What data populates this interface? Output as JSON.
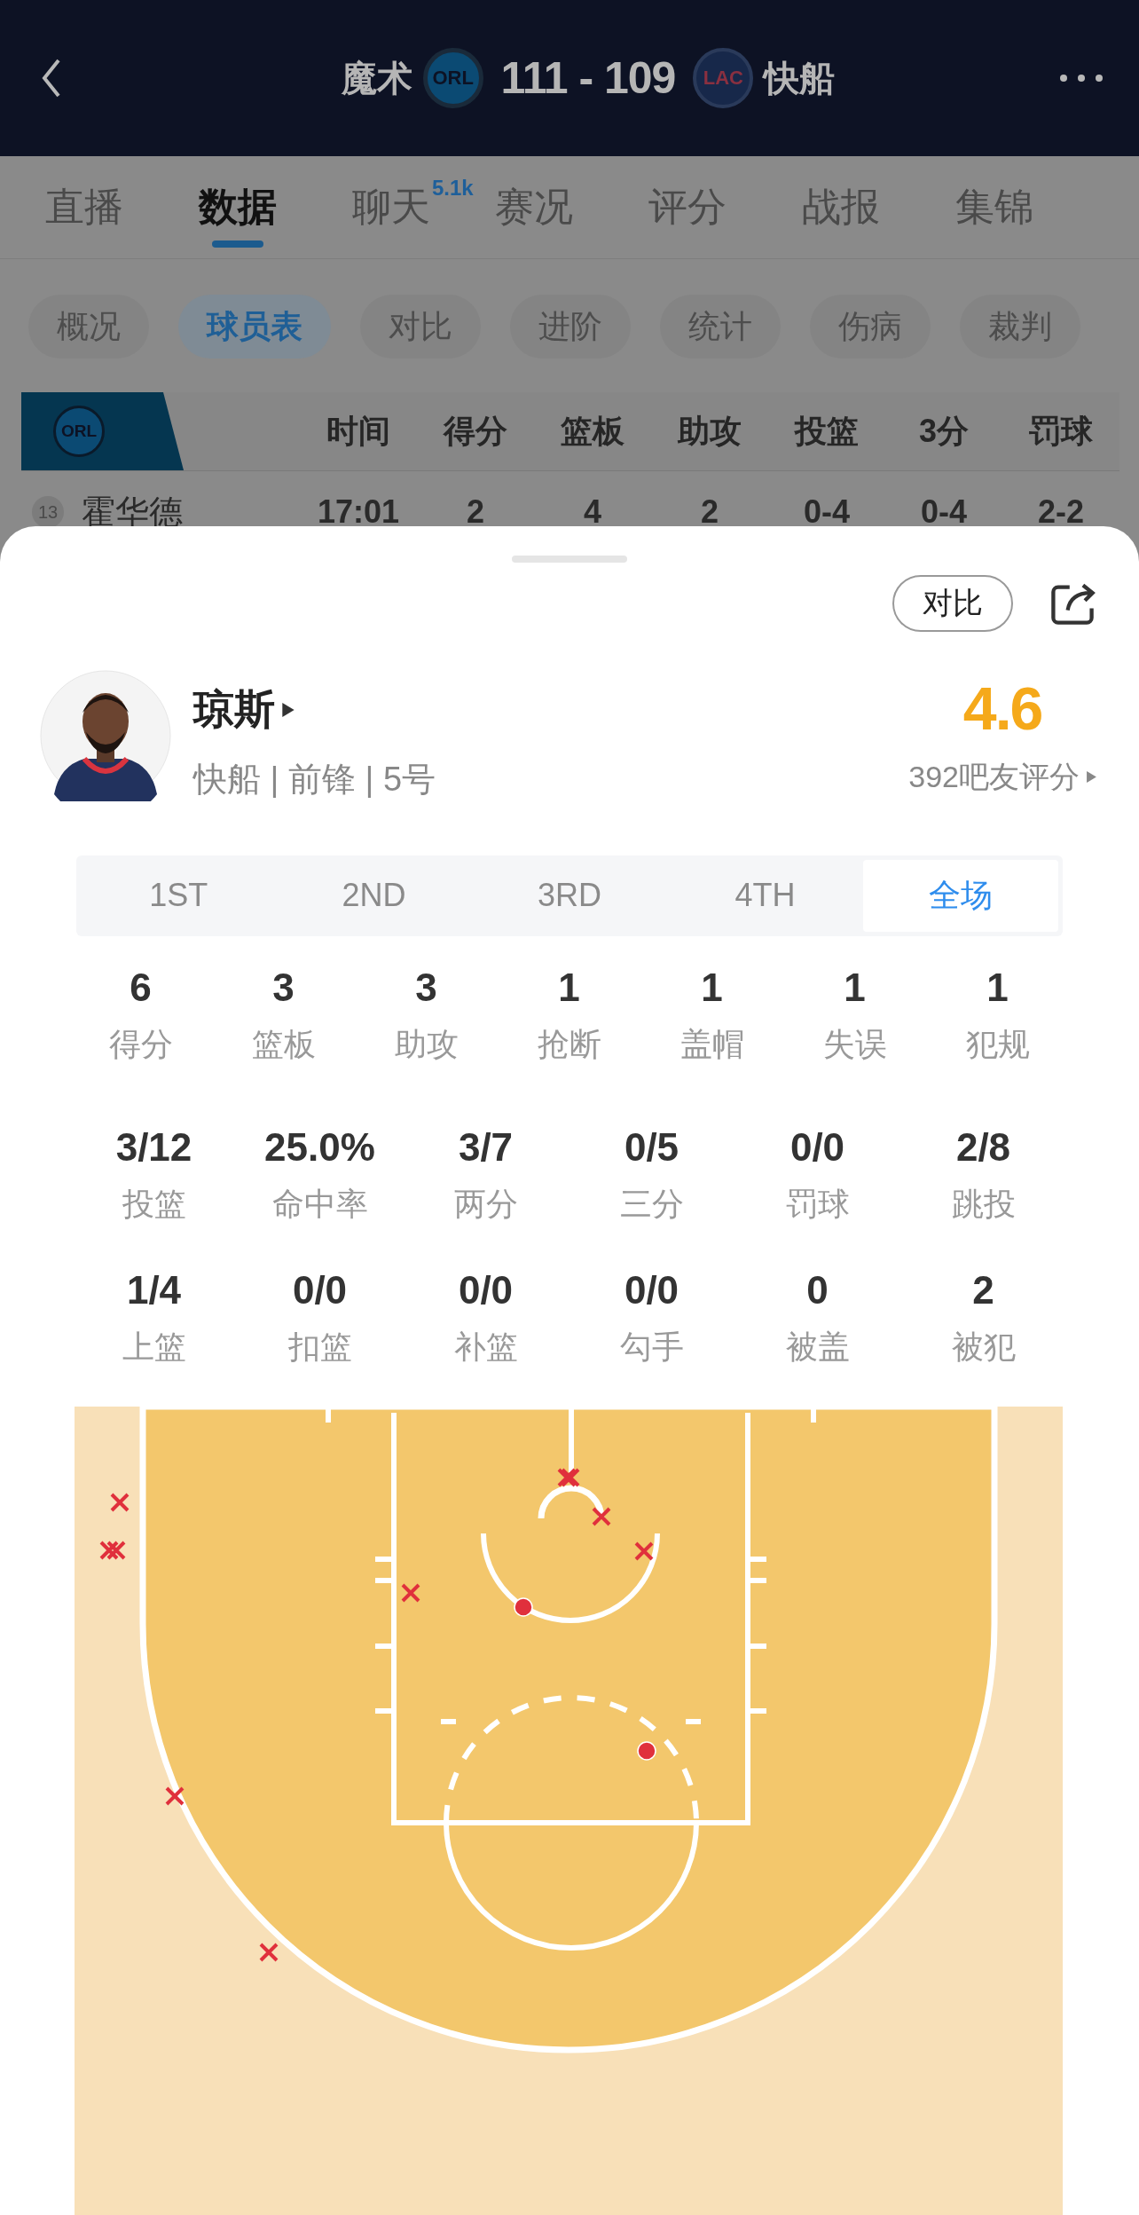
{
  "header": {
    "home_team": "魔术",
    "home_logo": "ORL",
    "score": "111 - 109",
    "away_logo": "LAC",
    "away_team": "快船"
  },
  "tabs": [
    {
      "label": "直播",
      "selected": false
    },
    {
      "label": "数据",
      "selected": true
    },
    {
      "label": "聊天",
      "badge": "5.1k",
      "selected": false
    },
    {
      "label": "赛况",
      "selected": false
    },
    {
      "label": "评分",
      "selected": false
    },
    {
      "label": "战报",
      "selected": false
    },
    {
      "label": "集锦",
      "selected": false
    }
  ],
  "subtabs": [
    {
      "label": "概况",
      "selected": false
    },
    {
      "label": "球员表",
      "selected": true
    },
    {
      "label": "对比",
      "selected": false
    },
    {
      "label": "进阶",
      "selected": false
    },
    {
      "label": "统计",
      "selected": false
    },
    {
      "label": "伤病",
      "selected": false
    },
    {
      "label": "裁判",
      "selected": false
    }
  ],
  "box_score": {
    "team_logo": "ORL",
    "columns": [
      "时间",
      "得分",
      "篮板",
      "助攻",
      "投篮",
      "3分",
      "罚球"
    ],
    "rows": [
      {
        "number": "13",
        "name": "霍华德",
        "cells": [
          "17:01",
          "2",
          "4",
          "2",
          "0-4",
          "0-4",
          "2-2"
        ]
      }
    ]
  },
  "player_sheet": {
    "compare_button": "对比",
    "player": {
      "name": "琼斯",
      "info": "快船 | 前锋 | 5号",
      "rating": "4.6",
      "rating_count": "392吧友评分"
    },
    "periods": [
      {
        "label": "1ST",
        "selected": false
      },
      {
        "label": "2ND",
        "selected": false
      },
      {
        "label": "3RD",
        "selected": false
      },
      {
        "label": "4TH",
        "selected": false
      },
      {
        "label": "全场",
        "selected": true
      }
    ],
    "main_stats": [
      {
        "value": "6",
        "label": "得分"
      },
      {
        "value": "3",
        "label": "篮板"
      },
      {
        "value": "3",
        "label": "助攻"
      },
      {
        "value": "1",
        "label": "抢断"
      },
      {
        "value": "1",
        "label": "盖帽"
      },
      {
        "value": "1",
        "label": "失误"
      },
      {
        "value": "1",
        "label": "犯规"
      }
    ],
    "shooting_stats": [
      [
        {
          "value": "3/12",
          "label": "投篮"
        },
        {
          "value": "25.0%",
          "label": "命中率"
        },
        {
          "value": "3/7",
          "label": "两分"
        },
        {
          "value": "0/5",
          "label": "三分"
        },
        {
          "value": "0/0",
          "label": "罚球"
        },
        {
          "value": "2/8",
          "label": "跳投"
        }
      ],
      [
        {
          "value": "1/4",
          "label": "上篮"
        },
        {
          "value": "0/0",
          "label": "扣篮"
        },
        {
          "value": "0/0",
          "label": "补篮"
        },
        {
          "value": "0/0",
          "label": "勾手"
        },
        {
          "value": "0",
          "label": "被盖"
        },
        {
          "value": "2",
          "label": "被犯"
        }
      ]
    ]
  }
}
